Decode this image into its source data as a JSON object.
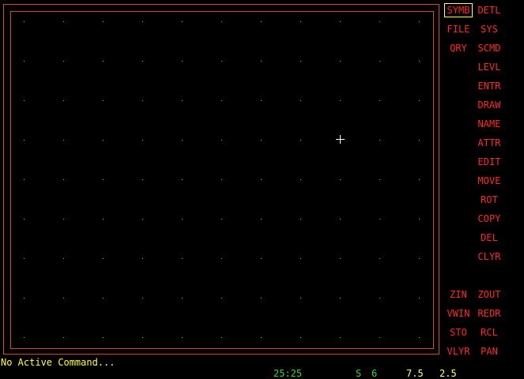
{
  "menu": {
    "left_column": [
      "SYMB",
      "FILE",
      "QRY"
    ],
    "right_column": [
      "DETL",
      "SYS",
      "SCMD",
      "LEVL",
      "ENTR",
      "DRAW",
      "NAME",
      "ATTR",
      "EDIT",
      "MOVE",
      "ROT",
      "COPY",
      "DEL",
      "CLYR"
    ],
    "view_left": [
      "ZIN",
      "VWIN",
      "STO",
      "VLYR"
    ],
    "view_right": [
      "ZOUT",
      "REDR",
      "RCL",
      "PAN"
    ],
    "selected": "SYMB"
  },
  "status": {
    "command": "No Active Command...",
    "coords": "25:25",
    "snap": "S",
    "snap_value": "6",
    "grid_x": "7.5",
    "grid_y": "2.5"
  },
  "colors": {
    "menu_text": "#ff2a2a",
    "frame": "#d05020",
    "status_text": "#ffff40",
    "readout_green": "#40d040",
    "readout_white": "#ffff80",
    "grid_dot": "#b0b060"
  }
}
